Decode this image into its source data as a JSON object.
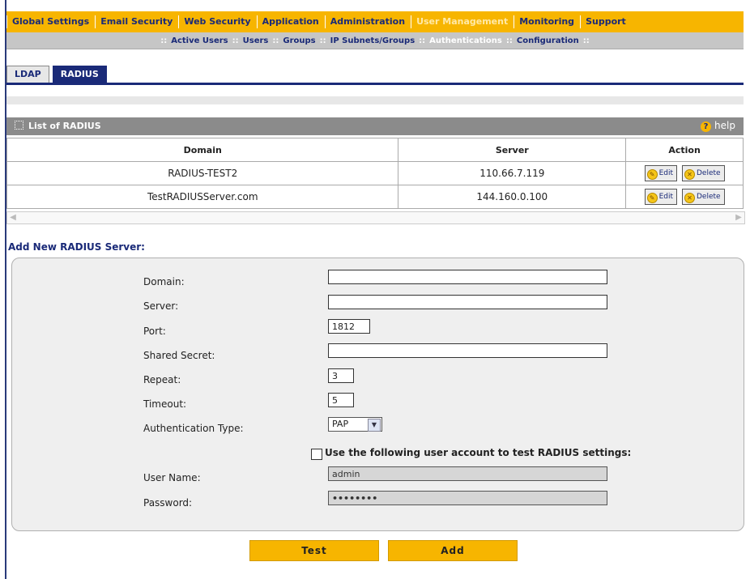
{
  "topnav": {
    "items": [
      "Global Settings",
      "Email Security",
      "Web Security",
      "Application",
      "Administration",
      "User Management",
      "Monitoring",
      "Support"
    ],
    "active_index": 5
  },
  "subnav": {
    "items": [
      "Active Users",
      "Users",
      "Groups",
      "IP Subnets/Groups",
      "Authentications",
      "Configuration"
    ],
    "active_index": 4,
    "separator": "::"
  },
  "tabs": {
    "ldap": "LDAP",
    "radius": "RADIUS"
  },
  "list": {
    "title": "List of RADIUS",
    "help": "help",
    "columns": {
      "domain": "Domain",
      "server": "Server",
      "action": "Action"
    },
    "rows": [
      {
        "domain": "RADIUS-TEST2",
        "server": "110.66.7.119"
      },
      {
        "domain": "TestRADIUSServer.com",
        "server": "144.160.0.100"
      }
    ],
    "edit_label": "Edit",
    "delete_label": "Delete"
  },
  "form": {
    "section_title": "Add New RADIUS Server:",
    "domain_label": "Domain:",
    "domain_value": "",
    "server_label": "Server:",
    "server_value": "",
    "port_label": "Port:",
    "port_value": "1812",
    "secret_label": "Shared Secret:",
    "secret_value": "",
    "repeat_label": "Repeat:",
    "repeat_value": "3",
    "timeout_label": "Timeout:",
    "timeout_value": "5",
    "auth_type_label": "Authentication Type:",
    "auth_type_value": "PAP",
    "test_checkbox_label": "Use the following user account to test RADIUS settings:",
    "username_label": "User Name:",
    "username_value": "admin",
    "password_label": "Password:",
    "password_value": "••••••••"
  },
  "buttons": {
    "test": "Test",
    "add": "Add"
  },
  "colors": {
    "accent": "#f7b500",
    "navy": "#1a2a78",
    "panel": "#efefef"
  }
}
